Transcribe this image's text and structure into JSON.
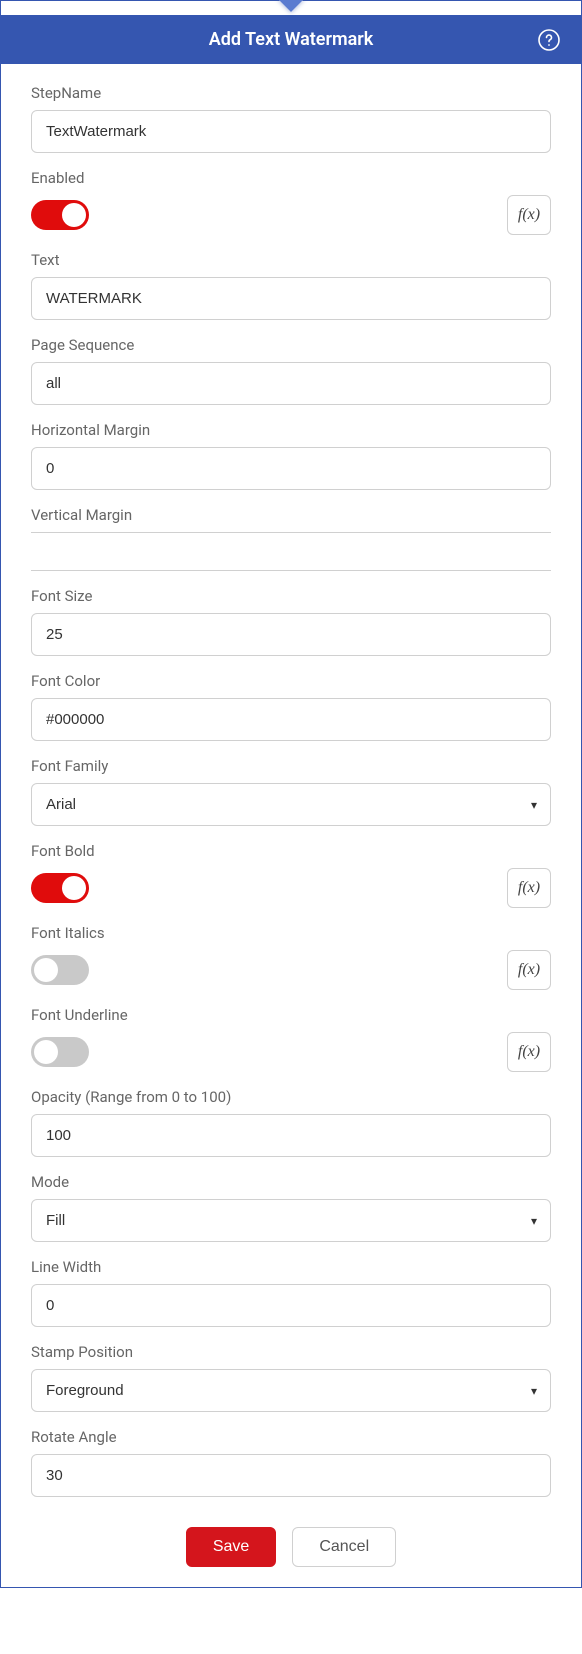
{
  "header": {
    "title": "Add Text Watermark"
  },
  "fields": {
    "stepName": {
      "label": "StepName",
      "value": "TextWatermark"
    },
    "enabled": {
      "label": "Enabled",
      "on": true,
      "fx": "f(x)"
    },
    "text": {
      "label": "Text",
      "value": "WATERMARK"
    },
    "pageSequence": {
      "label": "Page Sequence",
      "value": "all"
    },
    "hMargin": {
      "label": "Horizontal Margin",
      "value": "0"
    },
    "vMargin": {
      "label": "Vertical Margin",
      "value": ""
    },
    "fontSize": {
      "label": "Font Size",
      "value": "25"
    },
    "fontColor": {
      "label": "Font Color",
      "value": "#000000"
    },
    "fontFamily": {
      "label": "Font Family",
      "value": "Arial"
    },
    "fontBold": {
      "label": "Font Bold",
      "on": true,
      "fx": "f(x)"
    },
    "fontItalics": {
      "label": "Font Italics",
      "on": false,
      "fx": "f(x)"
    },
    "fontUnderline": {
      "label": "Font Underline",
      "on": false,
      "fx": "f(x)"
    },
    "opacity": {
      "label": "Opacity (Range from 0 to 100)",
      "value": "100"
    },
    "mode": {
      "label": "Mode",
      "value": "Fill"
    },
    "lineWidth": {
      "label": "Line Width",
      "value": "0"
    },
    "stampPosition": {
      "label": "Stamp Position",
      "value": "Foreground"
    },
    "rotateAngle": {
      "label": "Rotate Angle",
      "value": "30"
    }
  },
  "footer": {
    "save": "Save",
    "cancel": "Cancel"
  }
}
